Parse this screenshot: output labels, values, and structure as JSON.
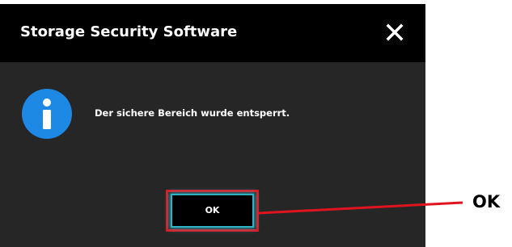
{
  "dialog": {
    "title": "Storage Security Software",
    "close_icon": "close-icon",
    "message_icon": "info-icon",
    "message": "Der sichere Bereich wurde entsperrt.",
    "ok_label": "OK"
  },
  "annotation": {
    "label": "OK",
    "highlight_color": "#e0141e"
  },
  "colors": {
    "titlebar": "#000000",
    "body": "#262626",
    "info_icon": "#1e88e5",
    "button_glow": "#2fb3c4"
  }
}
